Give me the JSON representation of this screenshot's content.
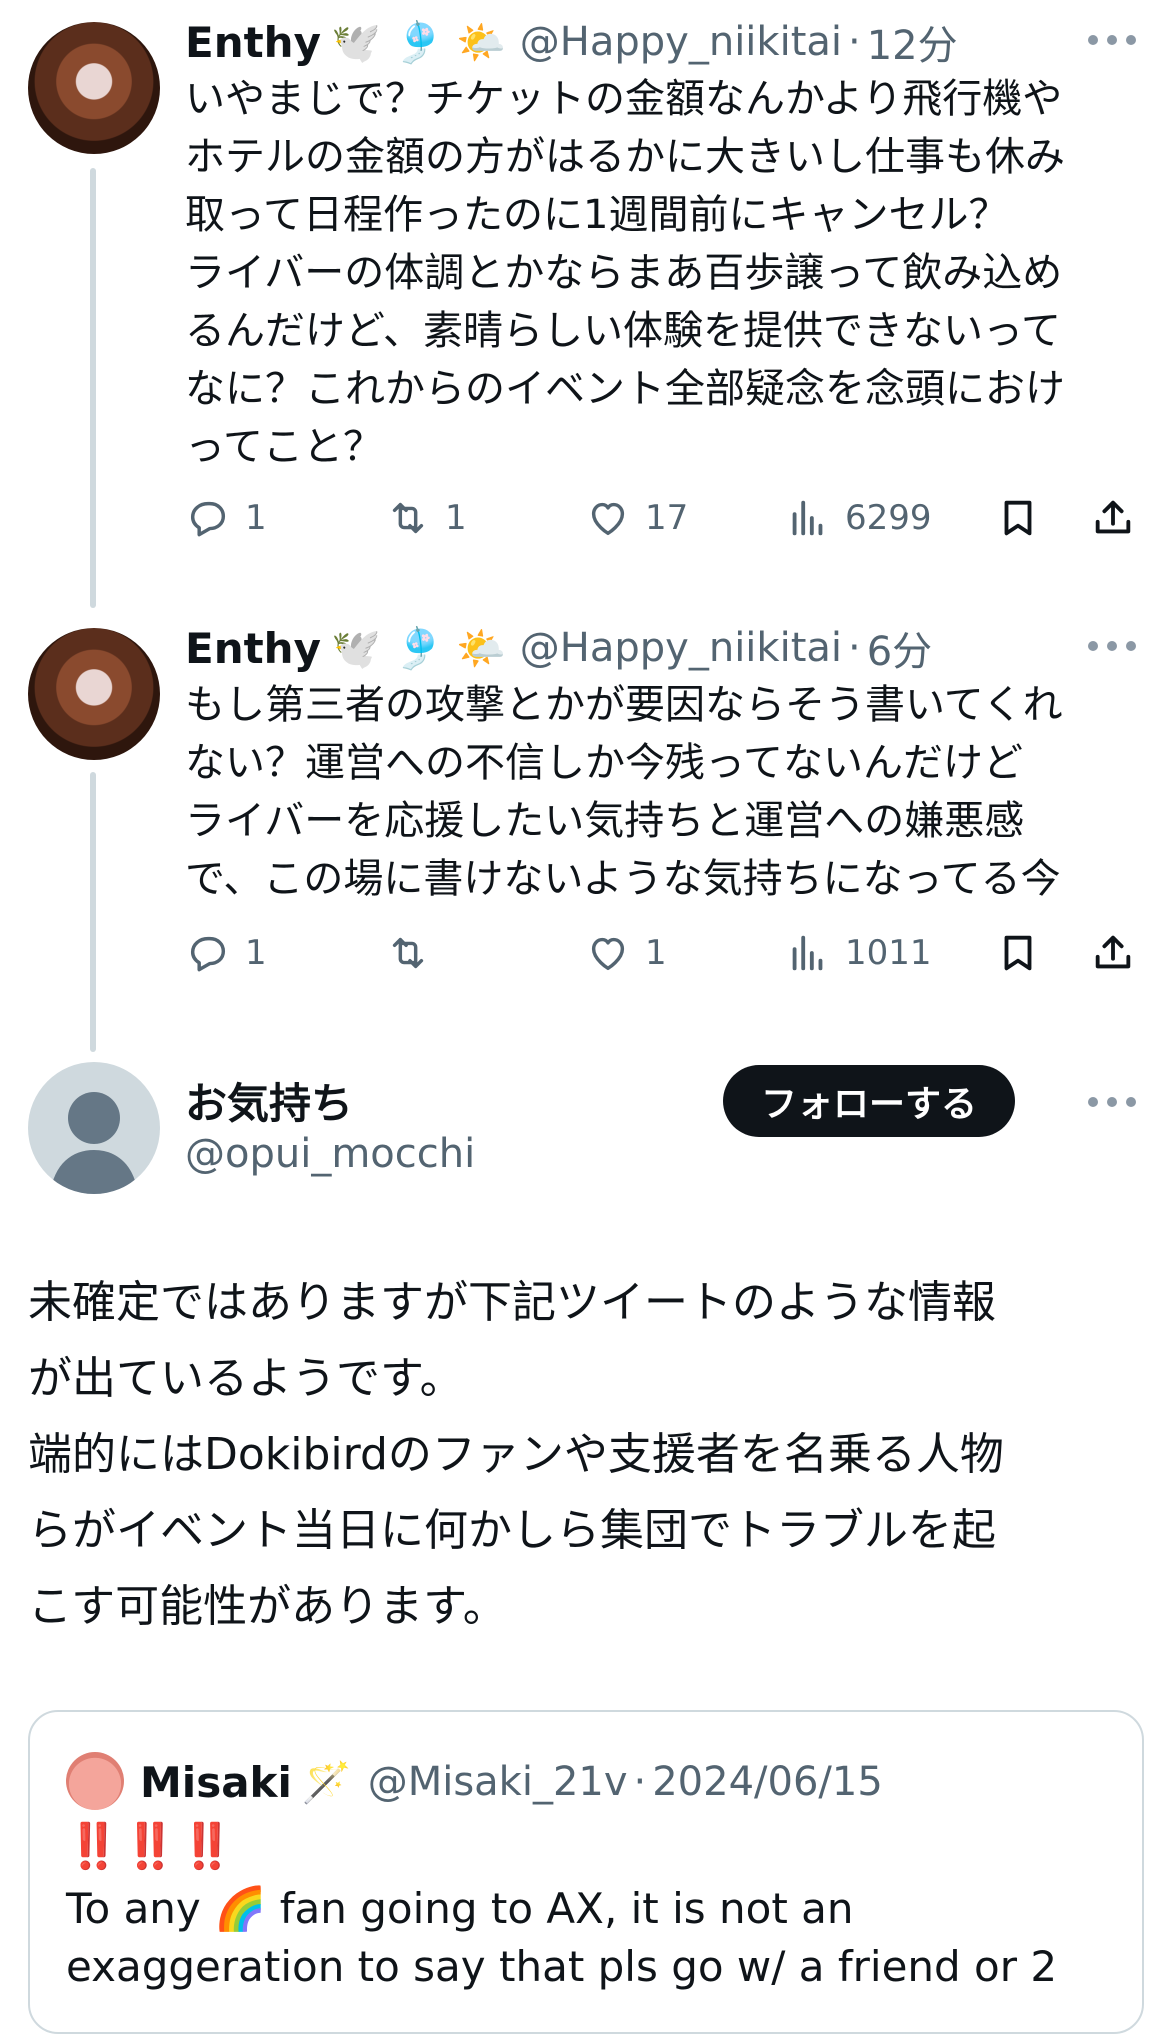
{
  "tweets": [
    {
      "name": "Enthy",
      "emojis": "🕊️ 🎐 🌤️",
      "handle": "@Happy_niikitai",
      "time": "12分",
      "text": "いやまじで？チケットの金額なんかより飛行機や\nホテルの金額の方がはるかに大きいし仕事も休み\n取って日程作ったのに1週間前にキャンセル？\nライバーの体調とかならまあ百歩譲って飲み込め\nるんだけど、素晴らしい体験を提供できないって\nなに？これからのイベント全部疑念を念頭におけ\nってこと？",
      "replies": "1",
      "retweets": "1",
      "likes": "17",
      "views": "6299"
    },
    {
      "name": "Enthy",
      "emojis": "🕊️ 🎐 🌤️",
      "handle": "@Happy_niikitai",
      "time": "6分",
      "text": "もし第三者の攻撃とかが要因ならそう書いてくれ\nない？運営への不信しか今残ってないんだけど\nライバーを応援したい気持ちと運営への嫌悪感\nで、この場に書けないような気持ちになってる今",
      "replies": "1",
      "retweets": "",
      "likes": "1",
      "views": "1011"
    }
  ],
  "main": {
    "name": "お気持ち",
    "handle": "@opui_mocchi",
    "follow_label": "フォローする",
    "text": "未確定ではありますが下記ツイートのような情報\nが出ているようです。\n端的にはDokibirdのファンや支援者を名乗る人物\nらがイベント当日に何かしら集団でトラブルを起\nこす可能性があります。"
  },
  "quote": {
    "name": "Misaki",
    "emoji": "🪄",
    "handle": "@Misaki_21v",
    "dot": "·",
    "date": "2024/06/15",
    "bangs": "‼️‼️‼️",
    "text": "To any 🌈 fan going to AX, it is not an\nexaggeration to say that pls go w/ a friend or 2"
  },
  "separator": "·",
  "icons": [
    "reply-icon",
    "retweet-icon",
    "like-icon",
    "views-icon",
    "bookmark-icon",
    "share-icon",
    "more-icon"
  ]
}
